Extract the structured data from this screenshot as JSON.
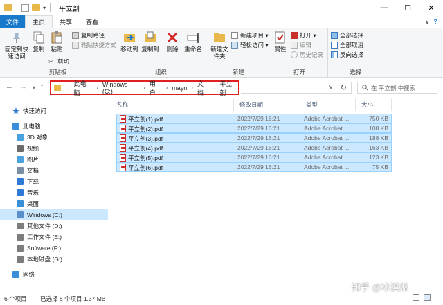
{
  "window": {
    "title": "平立剖",
    "quick_access_chevron": "▾",
    "controls": {
      "minimize": "—",
      "maximize": "☐",
      "close": "✕"
    }
  },
  "ribbon_tabs": [
    {
      "label": "文件",
      "state": "file"
    },
    {
      "label": "主页",
      "state": "active"
    },
    {
      "label": "共享",
      "state": "normal"
    },
    {
      "label": "查看",
      "state": "normal"
    }
  ],
  "ribbon_right": {
    "collapse": "∨",
    "help": "?"
  },
  "groups": {
    "clipboard": {
      "label": "剪贴板",
      "pin": "固定到快速访问",
      "copy": "复制",
      "paste": "粘贴",
      "copy_path": "复制路径",
      "paste_shortcut": "粘贴快捷方式",
      "cut": "剪切"
    },
    "organize": {
      "label": "组织",
      "move_to": "移动到",
      "copy_to": "复制到",
      "delete": "删除",
      "rename": "重命名"
    },
    "new": {
      "label": "新建",
      "new_folder": "新建文件夹",
      "new_item": "新建项目 ▾",
      "easy_access": "轻松访问 ▾"
    },
    "open": {
      "label": "打开",
      "properties": "属性",
      "open": "打开 ▾",
      "edit": "编辑",
      "history": "历史记录"
    },
    "select": {
      "label": "选择",
      "select_all": "全部选择",
      "select_none": "全部取消",
      "invert": "反向选择"
    }
  },
  "address": {
    "back": "←",
    "forward": "→",
    "recent": "∨",
    "up": "↑",
    "path": [
      "此电脑",
      "Windows (C:)",
      "用户",
      "mayn",
      "文档",
      "平立剖"
    ],
    "separator": "›",
    "refresh": "↻",
    "search_placeholder": "在 平立剖 中搜索"
  },
  "nav_pane": [
    {
      "label": "快速访问",
      "icon": "star-icon",
      "color": "#2f7ad6"
    },
    {
      "label": "此电脑",
      "icon": "computer-icon",
      "color": "#3a8fd9"
    },
    {
      "label": "3D 对象",
      "icon": "cube-icon",
      "color": "#4aa3df"
    },
    {
      "label": "视频",
      "icon": "video-icon",
      "color": "#6b6b6b"
    },
    {
      "label": "图片",
      "icon": "picture-icon",
      "color": "#4aa3df"
    },
    {
      "label": "文档",
      "icon": "document-icon",
      "color": "#7a8ea3"
    },
    {
      "label": "下载",
      "icon": "download-icon",
      "color": "#2f7ad6"
    },
    {
      "label": "音乐",
      "icon": "music-icon",
      "color": "#2f7ad6"
    },
    {
      "label": "桌面",
      "icon": "desktop-icon",
      "color": "#3a8fd9"
    },
    {
      "label": "Windows (C:)",
      "icon": "drive-icon",
      "color": "#5b8fc9",
      "selected": true
    },
    {
      "label": "其他文件 (D:)",
      "icon": "drive-icon",
      "color": "#7d7d7d"
    },
    {
      "label": "工作文件 (E:)",
      "icon": "drive-icon",
      "color": "#7d7d7d"
    },
    {
      "label": "Software (F:)",
      "icon": "drive-icon",
      "color": "#7d7d7d"
    },
    {
      "label": "本地磁盘 (G:)",
      "icon": "drive-icon",
      "color": "#7d7d7d"
    },
    {
      "label": "网络",
      "icon": "network-icon",
      "color": "#3a8fd9"
    }
  ],
  "columns": {
    "name": "名称",
    "modified": "修改日期",
    "type": "类型",
    "size": "大小"
  },
  "files": [
    {
      "name": "平立剖(1).pdf",
      "modified": "2022/7/29 16:21",
      "type": "Adobe Acrobat ...",
      "size": "750 KB"
    },
    {
      "name": "平立剖(2).pdf",
      "modified": "2022/7/29 16:21",
      "type": "Adobe Acrobat ...",
      "size": "108 KB"
    },
    {
      "name": "平立剖(3).pdf",
      "modified": "2022/7/29 16:21",
      "type": "Adobe Acrobat ...",
      "size": "188 KB"
    },
    {
      "name": "平立剖(4).pdf",
      "modified": "2022/7/29 16:21",
      "type": "Adobe Acrobat ...",
      "size": "163 KB"
    },
    {
      "name": "平立剖(5).pdf",
      "modified": "2022/7/29 16:21",
      "type": "Adobe Acrobat ...",
      "size": "123 KB"
    },
    {
      "name": "平立剖(6).pdf",
      "modified": "2022/7/29 16:21",
      "type": "Adobe Acrobat ...",
      "size": "75 KB"
    }
  ],
  "status": {
    "count": "6 个项目",
    "selected": "已选择 6 个项目 1.37 MB"
  },
  "watermark": "知乎 @冰淇淋",
  "colors": {
    "accent": "#1979ca",
    "selection": "#cce8ff",
    "highlight_box": "#e02020"
  }
}
